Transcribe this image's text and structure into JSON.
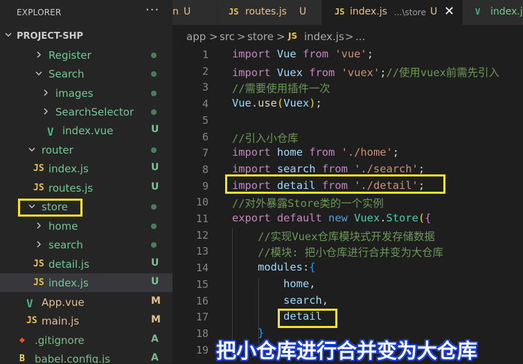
{
  "explorer": {
    "title": "EXPLORER",
    "more_label": "···",
    "project_name": "PROJECT-SHP"
  },
  "tree": [
    {
      "label": "Register",
      "kind": "folder",
      "status": "dot",
      "status_text": ""
    },
    {
      "label": "Search",
      "kind": "folder",
      "status": "dot",
      "status_text": ""
    },
    {
      "label": "images",
      "kind": "folder",
      "status": "dot",
      "status_text": ""
    },
    {
      "label": "SearchSelector",
      "kind": "folder",
      "status": "dot",
      "status_text": ""
    },
    {
      "label": "index.vue",
      "kind": "vue",
      "status": "badge",
      "status_text": "U"
    },
    {
      "label": "router",
      "kind": "folder",
      "status": "dot",
      "status_text": ""
    },
    {
      "label": "index.js",
      "kind": "js",
      "status": "badge",
      "status_text": "U"
    },
    {
      "label": "routes.js",
      "kind": "js",
      "status": "badge",
      "status_text": "U"
    },
    {
      "label": "store",
      "kind": "folder",
      "status": "dot",
      "status_text": ""
    },
    {
      "label": "home",
      "kind": "folder",
      "status": "dot",
      "status_text": ""
    },
    {
      "label": "search",
      "kind": "folder",
      "status": "dot",
      "status_text": ""
    },
    {
      "label": "detail.js",
      "kind": "js",
      "status": "badge",
      "status_text": "U"
    },
    {
      "label": "index.js",
      "kind": "js",
      "status": "badge",
      "status_text": "U"
    },
    {
      "label": "App.vue",
      "kind": "vue",
      "status": "badge",
      "status_text": "M"
    },
    {
      "label": "main.js",
      "kind": "js",
      "status": "badge",
      "status_text": "M"
    },
    {
      "label": ".gitignore",
      "kind": "git",
      "status": "badge",
      "status_text": "A"
    },
    {
      "label": "babel.config.js",
      "kind": "babel",
      "status": "badge",
      "status_text": "A"
    }
  ],
  "tabs": [
    {
      "name": "n",
      "path": "",
      "mark": "U",
      "icon": "",
      "active": false
    },
    {
      "name": "routes.js",
      "path": "",
      "mark": "U",
      "icon": "JS",
      "active": false
    },
    {
      "name": "index.js",
      "path": "...\\store",
      "mark": "U",
      "icon": "JS",
      "active": true,
      "close": "✕"
    },
    {
      "name": "index.js",
      "path": "",
      "mark": "",
      "icon": "V",
      "active": false
    }
  ],
  "breadcrumbs": [
    "app",
    ">",
    "src",
    ">",
    "store",
    ">",
    "JS",
    "index.js",
    ">",
    "..."
  ],
  "code_lines": [
    {
      "n": "1",
      "tokens": [
        [
          "kw",
          "import"
        ],
        [
          "pn",
          " "
        ],
        [
          "id",
          "Vue"
        ],
        [
          "pn",
          " "
        ],
        [
          "kw",
          "from"
        ],
        [
          "pn",
          " "
        ],
        [
          "str",
          "'vue'"
        ],
        [
          "pn",
          ";"
        ]
      ]
    },
    {
      "n": "2",
      "tokens": [
        [
          "kw",
          "import"
        ],
        [
          "pn",
          " "
        ],
        [
          "id",
          "Vuex"
        ],
        [
          "pn",
          " "
        ],
        [
          "kw",
          "from"
        ],
        [
          "pn",
          " "
        ],
        [
          "str",
          "'vuex'"
        ],
        [
          "pn",
          ";"
        ],
        [
          "cmt",
          "//使用vuex前需先引入"
        ]
      ]
    },
    {
      "n": "3",
      "tokens": [
        [
          "cmt",
          "//需要使用插件一次"
        ]
      ]
    },
    {
      "n": "4",
      "tokens": [
        [
          "id",
          "Vue"
        ],
        [
          "pn",
          "."
        ],
        [
          "fn",
          "use"
        ],
        [
          "br1",
          "("
        ],
        [
          "id",
          "Vuex"
        ],
        [
          "br1",
          ")"
        ],
        [
          "pn",
          ";"
        ]
      ]
    },
    {
      "n": "5",
      "tokens": []
    },
    {
      "n": "6",
      "tokens": [
        [
          "cmt",
          "//引入小仓库"
        ]
      ]
    },
    {
      "n": "7",
      "tokens": [
        [
          "kw",
          "import"
        ],
        [
          "pn",
          " "
        ],
        [
          "id",
          "home"
        ],
        [
          "pn",
          " "
        ],
        [
          "kw",
          "from"
        ],
        [
          "pn",
          " "
        ],
        [
          "str",
          "'./home'"
        ],
        [
          "pn",
          ";"
        ]
      ]
    },
    {
      "n": "8",
      "tokens": [
        [
          "kw",
          "import"
        ],
        [
          "pn",
          " "
        ],
        [
          "id",
          "search"
        ],
        [
          "pn",
          " "
        ],
        [
          "kw",
          "from"
        ],
        [
          "pn",
          " "
        ],
        [
          "str",
          "'./search'"
        ],
        [
          "pn",
          ";"
        ]
      ]
    },
    {
      "n": "9",
      "tokens": [
        [
          "kw",
          "import"
        ],
        [
          "pn",
          " "
        ],
        [
          "id",
          "detail"
        ],
        [
          "pn",
          " "
        ],
        [
          "kw",
          "from"
        ],
        [
          "pn",
          " "
        ],
        [
          "str",
          "'./detail'"
        ],
        [
          "pn",
          ";"
        ]
      ]
    },
    {
      "n": "10",
      "tokens": [
        [
          "cmt",
          "//对外暴露Store类的一个实例"
        ]
      ]
    },
    {
      "n": "11",
      "tokens": [
        [
          "kw",
          "export"
        ],
        [
          "pn",
          " "
        ],
        [
          "kw",
          "default"
        ],
        [
          "pn",
          " "
        ],
        [
          "kw2",
          "new"
        ],
        [
          "pn",
          " "
        ],
        [
          "cls",
          "Vuex"
        ],
        [
          "pn",
          "."
        ],
        [
          "cls",
          "Store"
        ],
        [
          "br1",
          "("
        ],
        [
          "br2",
          "{"
        ]
      ]
    },
    {
      "n": "12",
      "tokens": [
        [
          "pn",
          "    "
        ],
        [
          "cmt",
          "//实现Vuex仓库模块式开发存储数据"
        ]
      ]
    },
    {
      "n": "13",
      "tokens": [
        [
          "pn",
          "    "
        ],
        [
          "cmt",
          "//模块: 把小仓库进行合并变为大仓库"
        ]
      ]
    },
    {
      "n": "14",
      "tokens": [
        [
          "pn",
          "    "
        ],
        [
          "id",
          "modules"
        ],
        [
          "pn",
          ":"
        ],
        [
          "br3",
          "{"
        ]
      ]
    },
    {
      "n": "15",
      "tokens": [
        [
          "pn",
          "        "
        ],
        [
          "id",
          "home"
        ],
        [
          "pn",
          ","
        ]
      ]
    },
    {
      "n": "16",
      "tokens": [
        [
          "pn",
          "        "
        ],
        [
          "id",
          "search"
        ],
        [
          "pn",
          ","
        ]
      ]
    },
    {
      "n": "17",
      "tokens": [
        [
          "pn",
          "        "
        ],
        [
          "id",
          "detail"
        ]
      ]
    },
    {
      "n": "18",
      "tokens": [
        [
          "pn",
          "    "
        ],
        [
          "br3",
          "}"
        ]
      ]
    },
    {
      "n": "19",
      "tokens": []
    }
  ],
  "caption": "把小仓库进行合并变为大仓库",
  "colors": {
    "highlight": "#f5e625",
    "untracked": "#73c991",
    "modified": "#e2c08d",
    "added": "#81b88b",
    "dot": "#4b7d5a"
  }
}
